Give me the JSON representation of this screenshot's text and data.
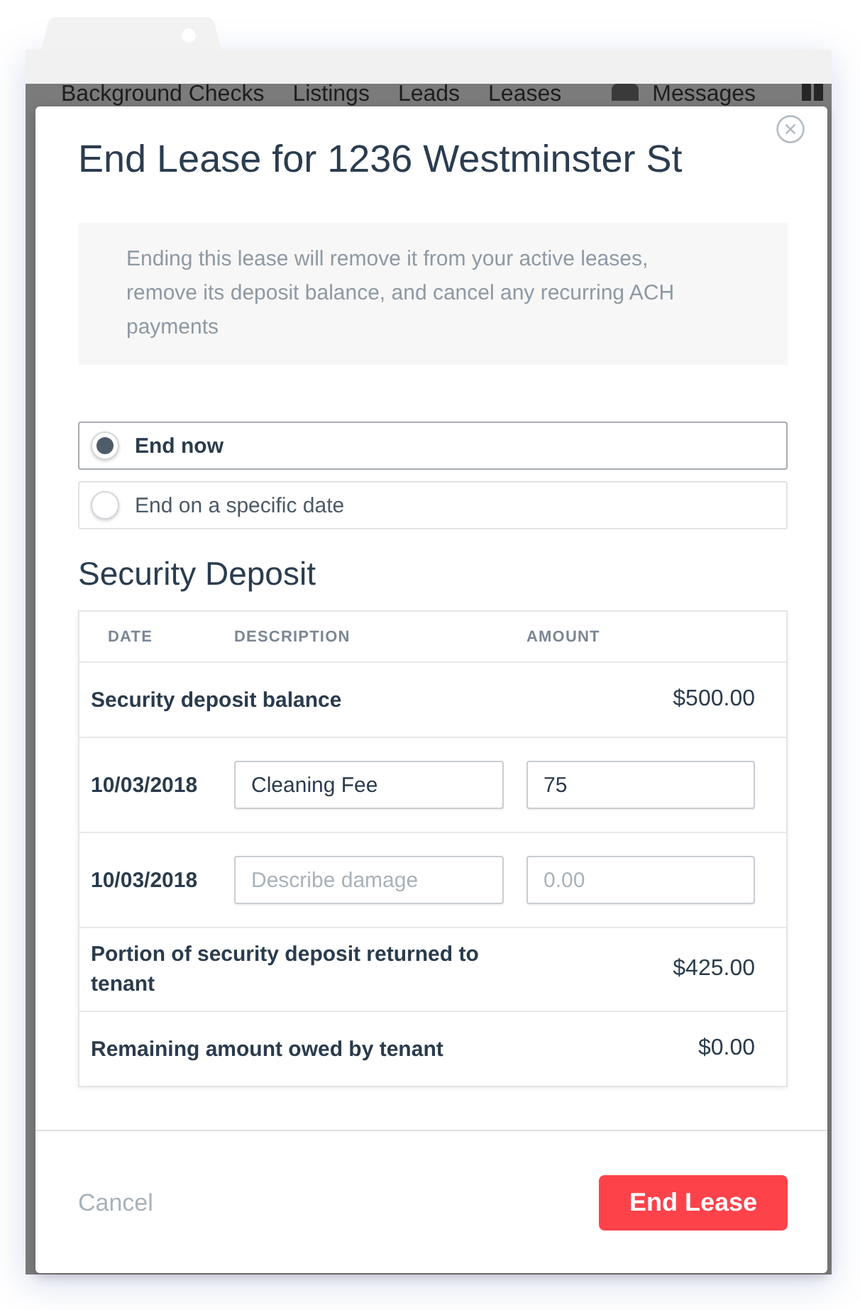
{
  "browser": {
    "nav_items": [
      {
        "label": "Background Checks",
        "kind": "link"
      },
      {
        "label": "Listings",
        "kind": "link"
      },
      {
        "label": "Leads",
        "kind": "link"
      },
      {
        "label": "Leases",
        "kind": "link"
      },
      {
        "label": "Messages",
        "kind": "messages"
      }
    ]
  },
  "dialog": {
    "title": "End Lease for 1236 Westminster St",
    "notice": "Ending this lease will remove it from your active leases, remove its deposit balance, and cancel any recurring ACH payments",
    "end_options": [
      {
        "label": "End now",
        "selected": true
      },
      {
        "label": "End on a specific date",
        "selected": false
      }
    ],
    "section_title": "Security Deposit",
    "table": {
      "columns": [
        "DATE",
        "DESCRIPTION",
        "AMOUNT"
      ],
      "rows": [
        {
          "kind": "total",
          "label": "Security deposit balance",
          "amount": "$500.00"
        },
        {
          "kind": "charge",
          "date": "10/03/2018",
          "description": {
            "value": "Cleaning Fee"
          },
          "amount": {
            "value": "75"
          }
        },
        {
          "kind": "charge",
          "date": "10/03/2018",
          "description": {
            "placeholder": "Describe damage"
          },
          "amount": {
            "placeholder": "0.00"
          }
        },
        {
          "kind": "total",
          "label": "Portion of security deposit returned to tenant",
          "amount": "$425.00"
        },
        {
          "kind": "total",
          "label": "Remaining amount owed by tenant",
          "amount": "$0.00"
        }
      ]
    },
    "buttons": [
      {
        "label": "Cancel",
        "kind": "link"
      },
      {
        "label": "End Lease",
        "kind": "primary"
      }
    ]
  }
}
